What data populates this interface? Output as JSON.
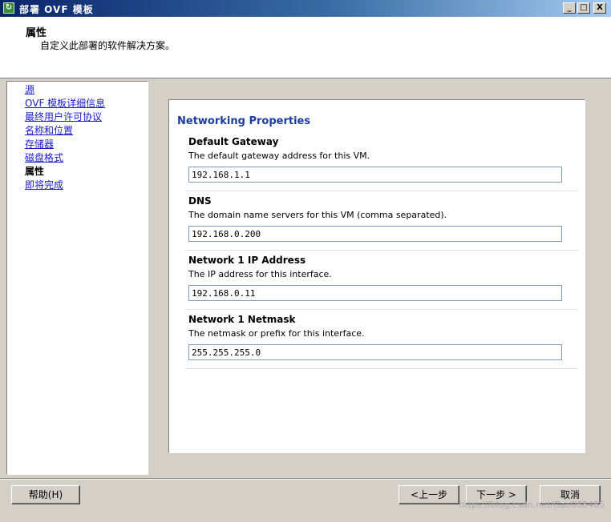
{
  "window": {
    "title": "部署 OVF 模板",
    "controls": {
      "minimize": "_",
      "maximize": "□",
      "close": "X"
    }
  },
  "header": {
    "title": "属性",
    "subtitle": "自定义此部署的软件解决方案。"
  },
  "nav": {
    "items": [
      {
        "label": "源"
      },
      {
        "label": "OVF 模板详细信息"
      },
      {
        "label": "最终用户许可协议"
      },
      {
        "label": "名称和位置"
      },
      {
        "label": "存储器"
      },
      {
        "label": "磁盘格式"
      },
      {
        "label": "属性"
      },
      {
        "label": "即将完成"
      }
    ]
  },
  "panel": {
    "title": "Networking Properties",
    "props": [
      {
        "name": "Default Gateway",
        "desc": "The default gateway address for this VM.",
        "value": "192.168.1.1"
      },
      {
        "name": "DNS",
        "desc": "The domain name servers for this VM (comma separated).",
        "value": "192.168.0.200"
      },
      {
        "name": "Network 1 IP Address",
        "desc": "The IP address for this interface.",
        "value": "192.168.0.11"
      },
      {
        "name": "Network 1 Netmask",
        "desc": "The netmask or prefix for this interface.",
        "value": "255.255.255.0"
      }
    ]
  },
  "buttons": {
    "help": "帮助(H)",
    "back": "<上一步",
    "next": "下一步 >",
    "cancel": "取消"
  },
  "watermark": "https://blog.csdn.net/Gao068465"
}
